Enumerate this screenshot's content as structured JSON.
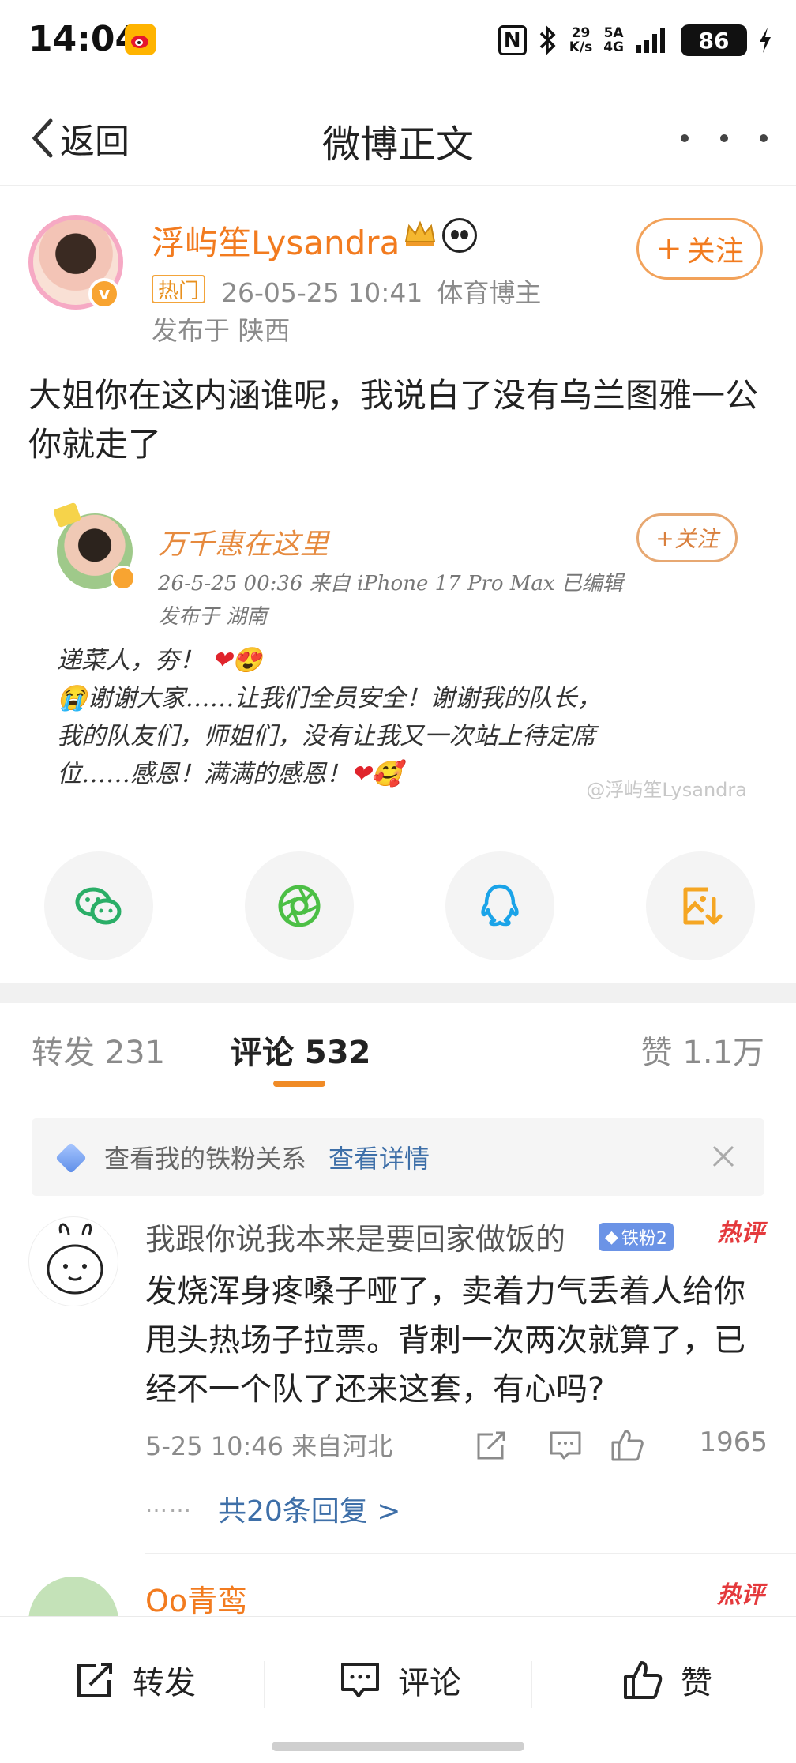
{
  "status_bar": {
    "time": "14:04",
    "net_speed_top": "29",
    "net_speed_bottom": "K/s",
    "network_top": "5A",
    "network_bottom": "4G",
    "battery": "86"
  },
  "nav": {
    "back_label": "返回",
    "title": "微博正文"
  },
  "post": {
    "author": "浮屿笙Lysandra",
    "hot_tag": "热门",
    "datetime": "26-05-25 10:41",
    "author_role": "体育博主",
    "location": "发布于 陕西",
    "follow_label": "关注",
    "text": "大姐你在这内涵谁呢，我说白了没有乌兰图雅一公你就走了",
    "embedded": {
      "name": "万千惠在这里",
      "meta": "26-5-25 00:36  来自 iPhone 17 Pro Max  已编辑",
      "location": "发布于 湖南",
      "follow_label": "关注",
      "line1": "递菜人，夯！",
      "line2": "谢谢大家……让我们全员安全！谢谢我的队长，",
      "line3": "我的队友们，师姐们，没有让我又一次站上待定席",
      "line4": "位……感恩！满满的感恩！",
      "watermark": "@浮屿笙Lysandra"
    }
  },
  "share": {
    "items": [
      "wechat-icon",
      "moments-icon",
      "qq-icon",
      "save-image-icon"
    ],
    "colors": {
      "wechat": "#2aae67",
      "moments": "#4cbf45",
      "qq": "#1aa3e8",
      "save": "#f5a623"
    }
  },
  "tabs": {
    "reposts": "转发 231",
    "comments": "评论 532",
    "likes": "赞 1.1万"
  },
  "fan_banner": {
    "text": "查看我的铁粉关系",
    "link": "查看详情"
  },
  "comments": [
    {
      "name": "我跟你说我本来是要回家做饭的",
      "fan_tag": "铁粉2",
      "hot_label": "热评",
      "text": "发烧浑身疼嗓子哑了，卖着力气丢着人给你甩头热场子拉票。背刺一次两次就算了，已经不一个队了还来这套，有心吗?",
      "meta": "5-25 10:46 来自河北",
      "likes": "1965",
      "replies_dots": "……",
      "replies": "共20条回复 >"
    },
    {
      "name": "Oo青鸾",
      "hot_label": "热评"
    }
  ],
  "bottom_bar": {
    "repost": "转发",
    "comment": "评论",
    "like": "赞"
  },
  "colors": {
    "accent_orange": "#f27b1f",
    "link_blue": "#3e6fa8",
    "hot_red": "#e4393c"
  }
}
